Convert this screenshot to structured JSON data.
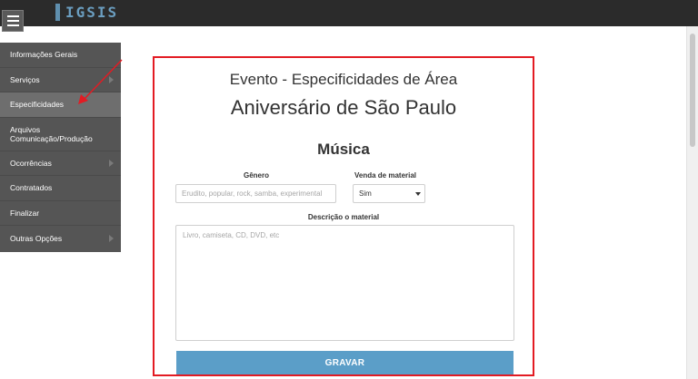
{
  "header": {
    "logo_text": "IGSIS",
    "accent": "#6b9ec0"
  },
  "sidebar": {
    "items": [
      {
        "label": "Informações Gerais",
        "has_submenu": false
      },
      {
        "label": "Serviços",
        "has_submenu": true
      },
      {
        "label": "Especificidades",
        "has_submenu": false,
        "active": true
      },
      {
        "label": "Arquivos Comunicação/Produção",
        "has_submenu": false
      },
      {
        "label": "Ocorrências",
        "has_submenu": true
      },
      {
        "label": "Contratados",
        "has_submenu": false
      },
      {
        "label": "Finalizar",
        "has_submenu": false
      },
      {
        "label": "Outras Opções",
        "has_submenu": true
      }
    ]
  },
  "form": {
    "title": "Evento - Especificidades de Área",
    "event_name": "Aniversário de São Paulo",
    "section": "Música",
    "genre_label": "Gênero",
    "genre_placeholder": "Erudito, popular, rock, samba, experimental",
    "sale_label": "Venda de material",
    "sale_value": "Sim",
    "description_label": "Descrição o material",
    "description_placeholder": "Livro, camiseta, CD, DVD, etc",
    "submit_label": "GRAVAR"
  },
  "colors": {
    "highlight_border": "#e31b23",
    "button": "#5b9ec8",
    "sidebar": "#555555"
  }
}
